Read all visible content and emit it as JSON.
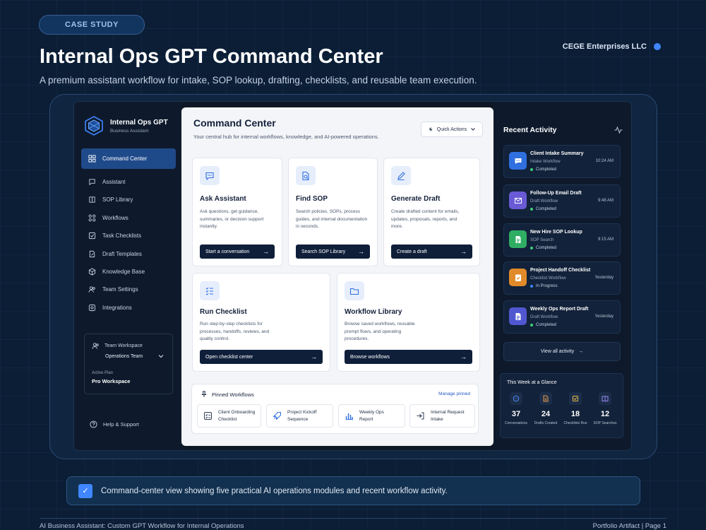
{
  "header": {
    "badge": "CASE STUDY",
    "title": "Internal Ops GPT Command Center",
    "subtitle": "A premium assistant workflow for intake, SOP lookup, drafting, checklists, and reusable team execution.",
    "company": "CEGE Enterprises LLC"
  },
  "sidebar": {
    "app_name": "Internal Ops GPT",
    "app_sub": "Business Assistant",
    "items": [
      {
        "label": "Command Center",
        "icon": "grid-icon"
      },
      {
        "label": "Assistant",
        "icon": "chat-bubble-icon"
      },
      {
        "label": "SOP Library",
        "icon": "book-icon"
      },
      {
        "label": "Workflows",
        "icon": "nodes-icon"
      },
      {
        "label": "Task Checklists",
        "icon": "checkbox-icon"
      },
      {
        "label": "Draft Templates",
        "icon": "document-edit-icon"
      },
      {
        "label": "Knowledge Base",
        "icon": "cube-icon"
      },
      {
        "label": "Team Settings",
        "icon": "users-icon"
      },
      {
        "label": "Integrations",
        "icon": "plug-icon"
      }
    ],
    "workspace_label": "Team Workspace",
    "workspace_value": "Operations Team",
    "plan_label": "Active Plan",
    "plan_value": "Pro Workspace",
    "help": "Help & Support"
  },
  "main": {
    "title": "Command Center",
    "subtitle": "Your central hub for internal workflows, knowledge, and AI-powered operations.",
    "quick_actions": "Quick Actions",
    "cards": [
      {
        "title": "Ask Assistant",
        "desc": "Ask questions, get guidance, summaries, or decision support instantly.",
        "button": "Start a conversation",
        "icon": "chat-icon"
      },
      {
        "title": "Find SOP",
        "desc": "Search policies, SOPs, process guides, and internal documentation in seconds.",
        "button": "Search SOP Library",
        "icon": "document-search-icon"
      },
      {
        "title": "Generate Draft",
        "desc": "Create drafted content for emails, updates, proposals, reports, and more.",
        "button": "Create a draft",
        "icon": "pencil-icon"
      },
      {
        "title": "Run Checklist",
        "desc": "Run step-by-step checklists for processes, handoffs, reviews, and quality control.",
        "button": "Open checklist center",
        "icon": "checklist-icon"
      },
      {
        "title": "Workflow Library",
        "desc": "Browse saved workflows, reusable prompt flows, and operating procedures.",
        "button": "Browse workflows",
        "icon": "folder-icon"
      }
    ],
    "pinned_title": "Pinned Workflows",
    "pinned_manage": "Manage pinned",
    "pinned": [
      {
        "line1": "Client Onboarding",
        "line2": "Checklist",
        "icon": "checklist-icon"
      },
      {
        "line1": "Project Kickoff",
        "line2": "Sequence",
        "icon": "rocket-icon"
      },
      {
        "line1": "Weekly Ops",
        "line2": "Report",
        "icon": "bar-chart-icon"
      },
      {
        "line1": "Internal Request",
        "line2": "Intake",
        "icon": "login-icon"
      }
    ]
  },
  "activity": {
    "title": "Recent Activity",
    "items": [
      {
        "title": "Client Intake Summary",
        "workflow": "Intake Workflow",
        "status": "Completed",
        "time": "10:24 AM",
        "color": "#2f6fe0",
        "status_color": "#3ecf7a",
        "icon": "chat-icon"
      },
      {
        "title": "Follow-Up Email Draft",
        "workflow": "Draft Workflow",
        "status": "Completed",
        "time": "9:48 AM",
        "color": "#6a5ad6",
        "status_color": "#3ecf7a",
        "icon": "mail-icon"
      },
      {
        "title": "New Hire SOP Lookup",
        "workflow": "SOP Search",
        "status": "Completed",
        "time": "9:15 AM",
        "color": "#2fae63",
        "status_color": "#3ecf7a",
        "icon": "document-icon"
      },
      {
        "title": "Project Handoff Checklist",
        "workflow": "Checklist Workflow",
        "status": "In Progress",
        "time": "Yesterday",
        "color": "#e08a2a",
        "status_color": "#3f86ff",
        "icon": "checklist-icon"
      },
      {
        "title": "Weekly Ops Report Draft",
        "workflow": "Draft Workflow",
        "status": "Completed",
        "time": "Yesterday",
        "color": "#5057d0",
        "status_color": "#3ecf7a",
        "icon": "document-icon"
      }
    ],
    "view_all": "View all activity",
    "glance_title": "This Week at a Glance",
    "stats": [
      {
        "value": "37",
        "label": "Conversations",
        "color": "#4f8ff7"
      },
      {
        "value": "24",
        "label": "Drafts Created",
        "color": "#e89a4a"
      },
      {
        "value": "18",
        "label": "Checklists Run",
        "color": "#e8b84a"
      },
      {
        "value": "12",
        "label": "SOP Searches",
        "color": "#9b86f0"
      }
    ]
  },
  "caption": "Command-center view showing five practical AI operations modules and recent workflow activity.",
  "footer": {
    "left": "AI Business Assistant: Custom GPT Workflow for Internal Operations",
    "right": "Portfolio Artifact | Page 1"
  }
}
